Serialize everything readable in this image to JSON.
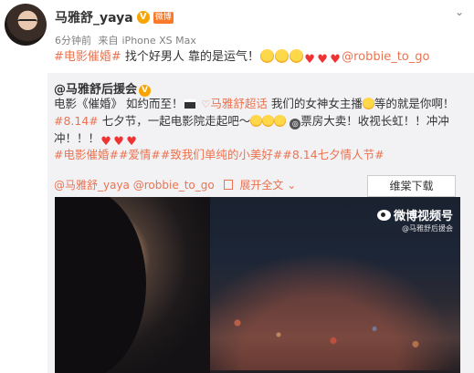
{
  "post": {
    "username": "马雅舒_yaya",
    "vip_badge": "V",
    "level_badge": "微博",
    "time": "6分钟前",
    "source_prefix": "来自",
    "source": "iPhone XS Max",
    "chevron": "⌄",
    "text": {
      "topic": "#电影催婚#",
      "body": " 找个好男人 靠的是运气！",
      "mention": "@robbie_to_go"
    }
  },
  "repost": {
    "author": "@马雅舒后援会",
    "author_badge": "V",
    "line1": {
      "a": "电影《催婚》 如约而至！",
      "b": "马雅舒超话",
      "c": " 我们的女神女主播",
      "d": "等的就是你啊！"
    },
    "line2": {
      "topic": "#8.14#",
      "a": " 七夕节，一起电影院走起吧～",
      "b": "票房大卖！收视长虹！！冲冲"
    },
    "line3": {
      "a": "冲！！！"
    },
    "line4": {
      "topics": "#电影催婚##爱情##致我们单纯的小美好##8.14七夕情人节#"
    },
    "bottom": {
      "mention1": "@马雅舒_yaya",
      "mention2": "@robbie_to_go",
      "expand": "展开全文",
      "expand_chevron": "⌄"
    },
    "download_button": "维棠下载",
    "video_watermark": {
      "main": "微博视频号",
      "sub": "@马雅舒后援会"
    }
  }
}
